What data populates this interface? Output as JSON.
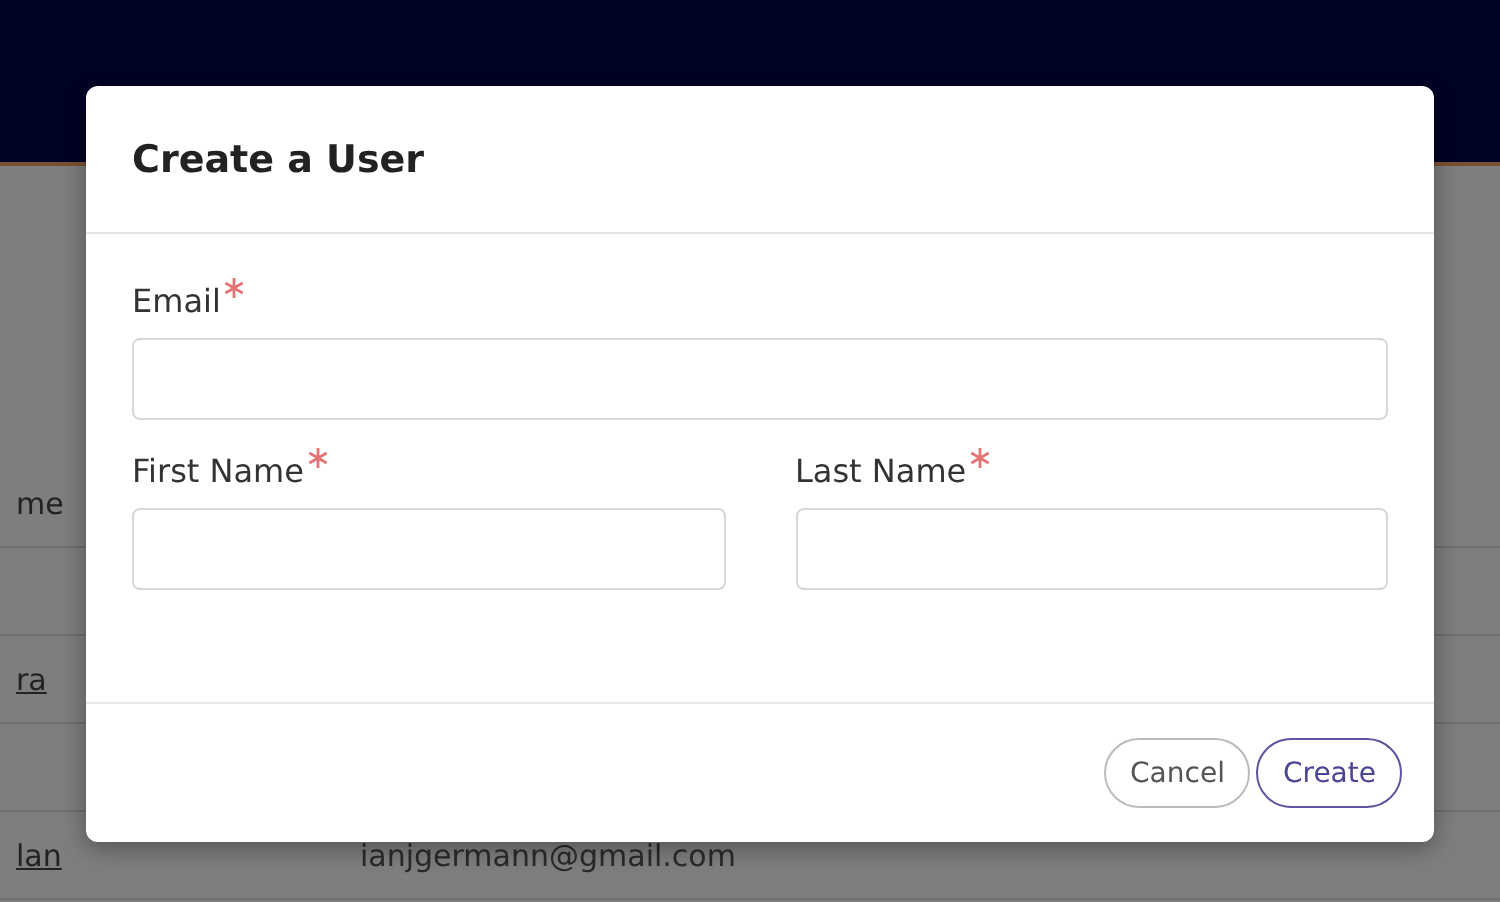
{
  "background_table": {
    "header": "me",
    "rows": [
      {
        "name": "ra"
      },
      {
        "name": "lan",
        "email": "ianjgermann@gmail.com"
      }
    ]
  },
  "dialog": {
    "title": "Create a User",
    "field_rows": [
      [
        {
          "label": "Email",
          "required": true
        }
      ],
      [
        {
          "label": "First Name",
          "required": true
        },
        {
          "label": "Last Name",
          "required": true
        }
      ]
    ],
    "buttons": [
      {
        "label": "Cancel",
        "kind": "secondary"
      },
      {
        "label": "Create",
        "kind": "primary"
      }
    ]
  }
}
